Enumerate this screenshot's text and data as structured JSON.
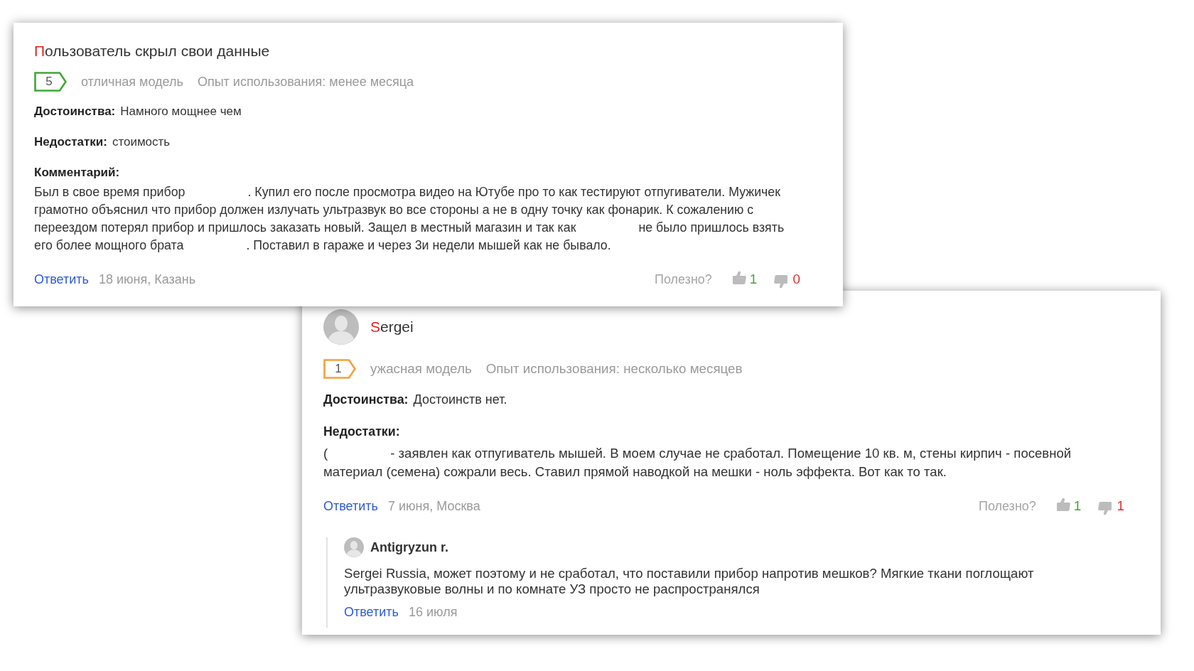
{
  "reviews": [
    {
      "author": "Пользователь скрыл свои данные",
      "has_avatar": false,
      "rating": {
        "value": "5",
        "verdict": "отличная модель",
        "color": "#3ea833"
      },
      "experience": "Опыт использования: менее месяца",
      "sections": [
        {
          "kind": "inline",
          "label": "Достоинства:",
          "text": "Намного мощнее чем"
        },
        {
          "kind": "inline",
          "label": "Недостатки:",
          "text": "стоимость"
        },
        {
          "kind": "block",
          "label": "Комментарий:",
          "lines": [
            [
              {
                "kind": "text",
                "text": "Был в свое время прибор"
              },
              {
                "kind": "redacted"
              },
              {
                "kind": "text",
                "text": ". Купил его после просмотра видео на Ютубе про то как тестируют отпугиватели. Мужичек"
              }
            ],
            [
              {
                "kind": "text",
                "text": "грамотно объяснил что прибор должен излучать ультразвук во все стороны а не в одну точку как фонарик. К сожалению с"
              }
            ],
            [
              {
                "kind": "text",
                "text": "переездом потерял прибор и пришлось заказать новый. Защел в местный магазин и так как"
              },
              {
                "kind": "redacted"
              },
              {
                "kind": "text",
                "text": "не было пришлось взять"
              }
            ],
            [
              {
                "kind": "text",
                "text": "его более мощного брата"
              },
              {
                "kind": "redacted"
              },
              {
                "kind": "text",
                "text": ". Поставил в гараже и через 3и недели мышей как не бывало."
              }
            ]
          ]
        }
      ],
      "reply_link": "Ответить",
      "date": "18 июня, Казань",
      "helpful": {
        "label": "Полезно?",
        "likes": "1",
        "dislikes": "0"
      }
    },
    {
      "author": "Sergei",
      "has_avatar": true,
      "rating": {
        "value": "1",
        "verdict": "ужасная модель",
        "color": "#f5a03a"
      },
      "experience": "Опыт использования: несколько месяцев",
      "sections": [
        {
          "kind": "inline",
          "label": "Достоинства:",
          "text": "Достоинств нет."
        },
        {
          "kind": "block",
          "label": "Недостатки:",
          "lines": [
            [
              {
                "kind": "text",
                "text": "("
              },
              {
                "kind": "redacted"
              },
              {
                "kind": "text",
                "text": "- заявлен как отпугиватель мышей. В моем случае не сработал. Помещение 10 кв. м, стены кирпич - посевной"
              }
            ],
            [
              {
                "kind": "text",
                "text": "материал (семена) сожрали весь. Ставил прямой наводкой на мешки - ноль эффекта. Вот как то так."
              }
            ]
          ]
        }
      ],
      "reply_link": "Ответить",
      "date": "7 июня, Москва",
      "helpful": {
        "label": "Полезно?",
        "likes": "1",
        "dislikes": "1"
      },
      "replies": [
        {
          "author": "Antigryzun r.",
          "has_avatar": true,
          "lines": [
            "Sergei Russia, может поэтому и не сработал, что поставили прибор напротив мешков? Мягкие ткани поглощают",
            "ультразвуковые волны и по комнате УЗ просто не распространялся"
          ],
          "reply_link": "Ответить",
          "date": "16 июля"
        }
      ]
    }
  ]
}
